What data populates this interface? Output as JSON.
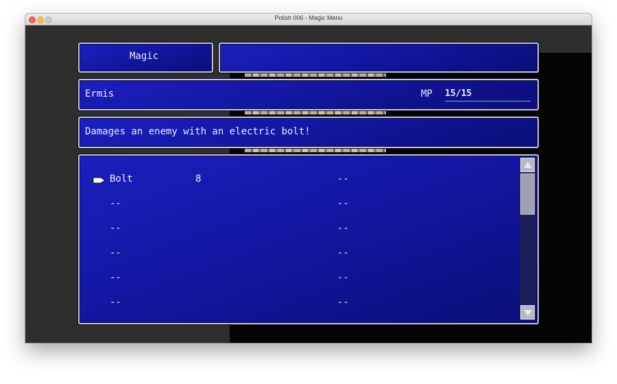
{
  "window": {
    "title": "Polish 006 - Magic Menu"
  },
  "menu": {
    "header_label": "Magic",
    "character_name": "Ermis",
    "mp_label": "MP",
    "mp_value": "15/15",
    "description": "Damages an enemy with an electric bolt!"
  },
  "spells": {
    "left": [
      {
        "name": "Bolt",
        "cost": "8"
      },
      {
        "name": "--",
        "cost": ""
      },
      {
        "name": "--",
        "cost": ""
      },
      {
        "name": "--",
        "cost": ""
      },
      {
        "name": "--",
        "cost": ""
      },
      {
        "name": "--",
        "cost": ""
      }
    ],
    "right": [
      {
        "name": "--"
      },
      {
        "name": "--"
      },
      {
        "name": "--"
      },
      {
        "name": "--"
      },
      {
        "name": "--"
      },
      {
        "name": "--"
      }
    ]
  },
  "icons": {
    "cursor": "pointing-hand-icon",
    "scroll_up": "triangle-up-icon",
    "scroll_down": "triangle-down-icon"
  },
  "colors": {
    "window_blue": "#1317a2",
    "window_border": "#c7c7d3",
    "text": "#ececf4"
  }
}
